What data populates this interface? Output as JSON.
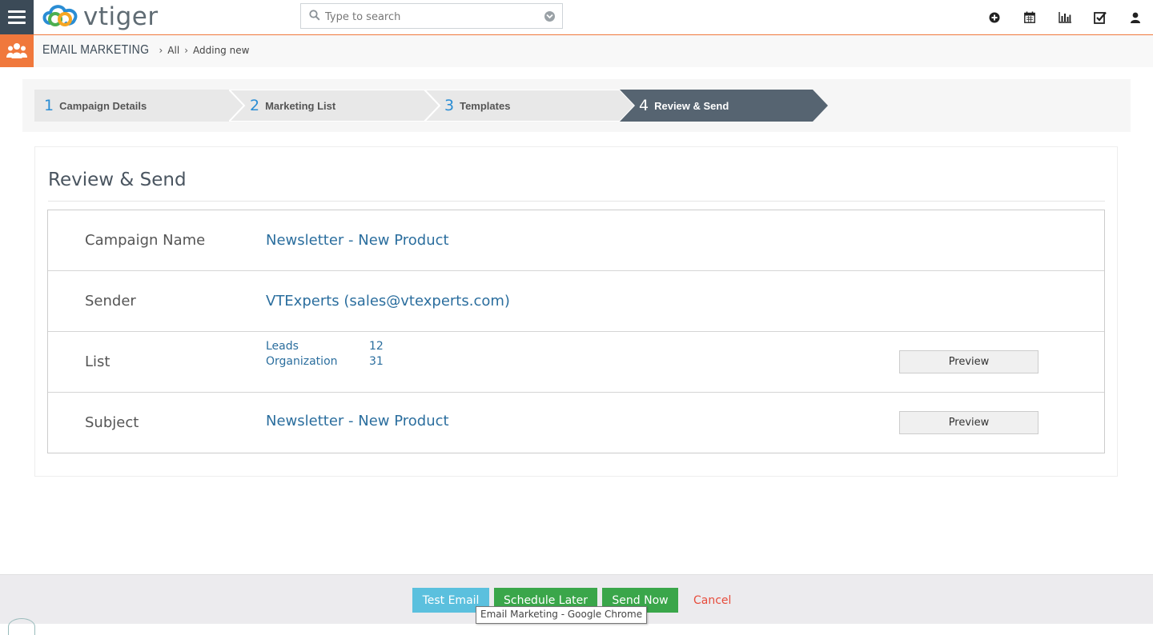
{
  "app": {
    "logo_text": "vtiger"
  },
  "search": {
    "placeholder": "Type to search"
  },
  "top_icons": [
    "plus-circle-icon",
    "calendar-icon",
    "bar-chart-icon",
    "task-check-icon",
    "user-icon"
  ],
  "breadcrumb": {
    "module": "EMAIL MARKETING",
    "items": [
      "All",
      "Adding new"
    ]
  },
  "steps": [
    {
      "num": "1",
      "label": "Campaign Details",
      "active": false
    },
    {
      "num": "2",
      "label": "Marketing List",
      "active": false
    },
    {
      "num": "3",
      "label": "Templates",
      "active": false
    },
    {
      "num": "4",
      "label": "Review & Send",
      "active": true
    }
  ],
  "review": {
    "title": "Review & Send",
    "campaign_name": {
      "label": "Campaign Name",
      "value": "Newsletter - New Product"
    },
    "sender": {
      "label": "Sender",
      "value": "VTExperts (sales@vtexperts.com)"
    },
    "list": {
      "label": "List",
      "items": [
        {
          "name": "Leads",
          "count": "12"
        },
        {
          "name": "Organization",
          "count": "31"
        }
      ],
      "preview_label": "Preview"
    },
    "subject": {
      "label": "Subject",
      "value": "Newsletter - New Product",
      "preview_label": "Preview"
    }
  },
  "footer": {
    "test_email": "Test Email",
    "schedule_later": "Schedule Later",
    "send_now": "Send Now",
    "cancel": "Cancel"
  },
  "tooltip": "Email Marketing - Google Chrome",
  "colors": {
    "accent": "#f0783c",
    "nav_dark": "#3b4a57",
    "active_step": "#566471",
    "link": "#2b6e9e",
    "step_num": "#2a8dd4",
    "success": "#3aa64a",
    "info": "#5bc0de",
    "danger": "#e74c3c"
  }
}
